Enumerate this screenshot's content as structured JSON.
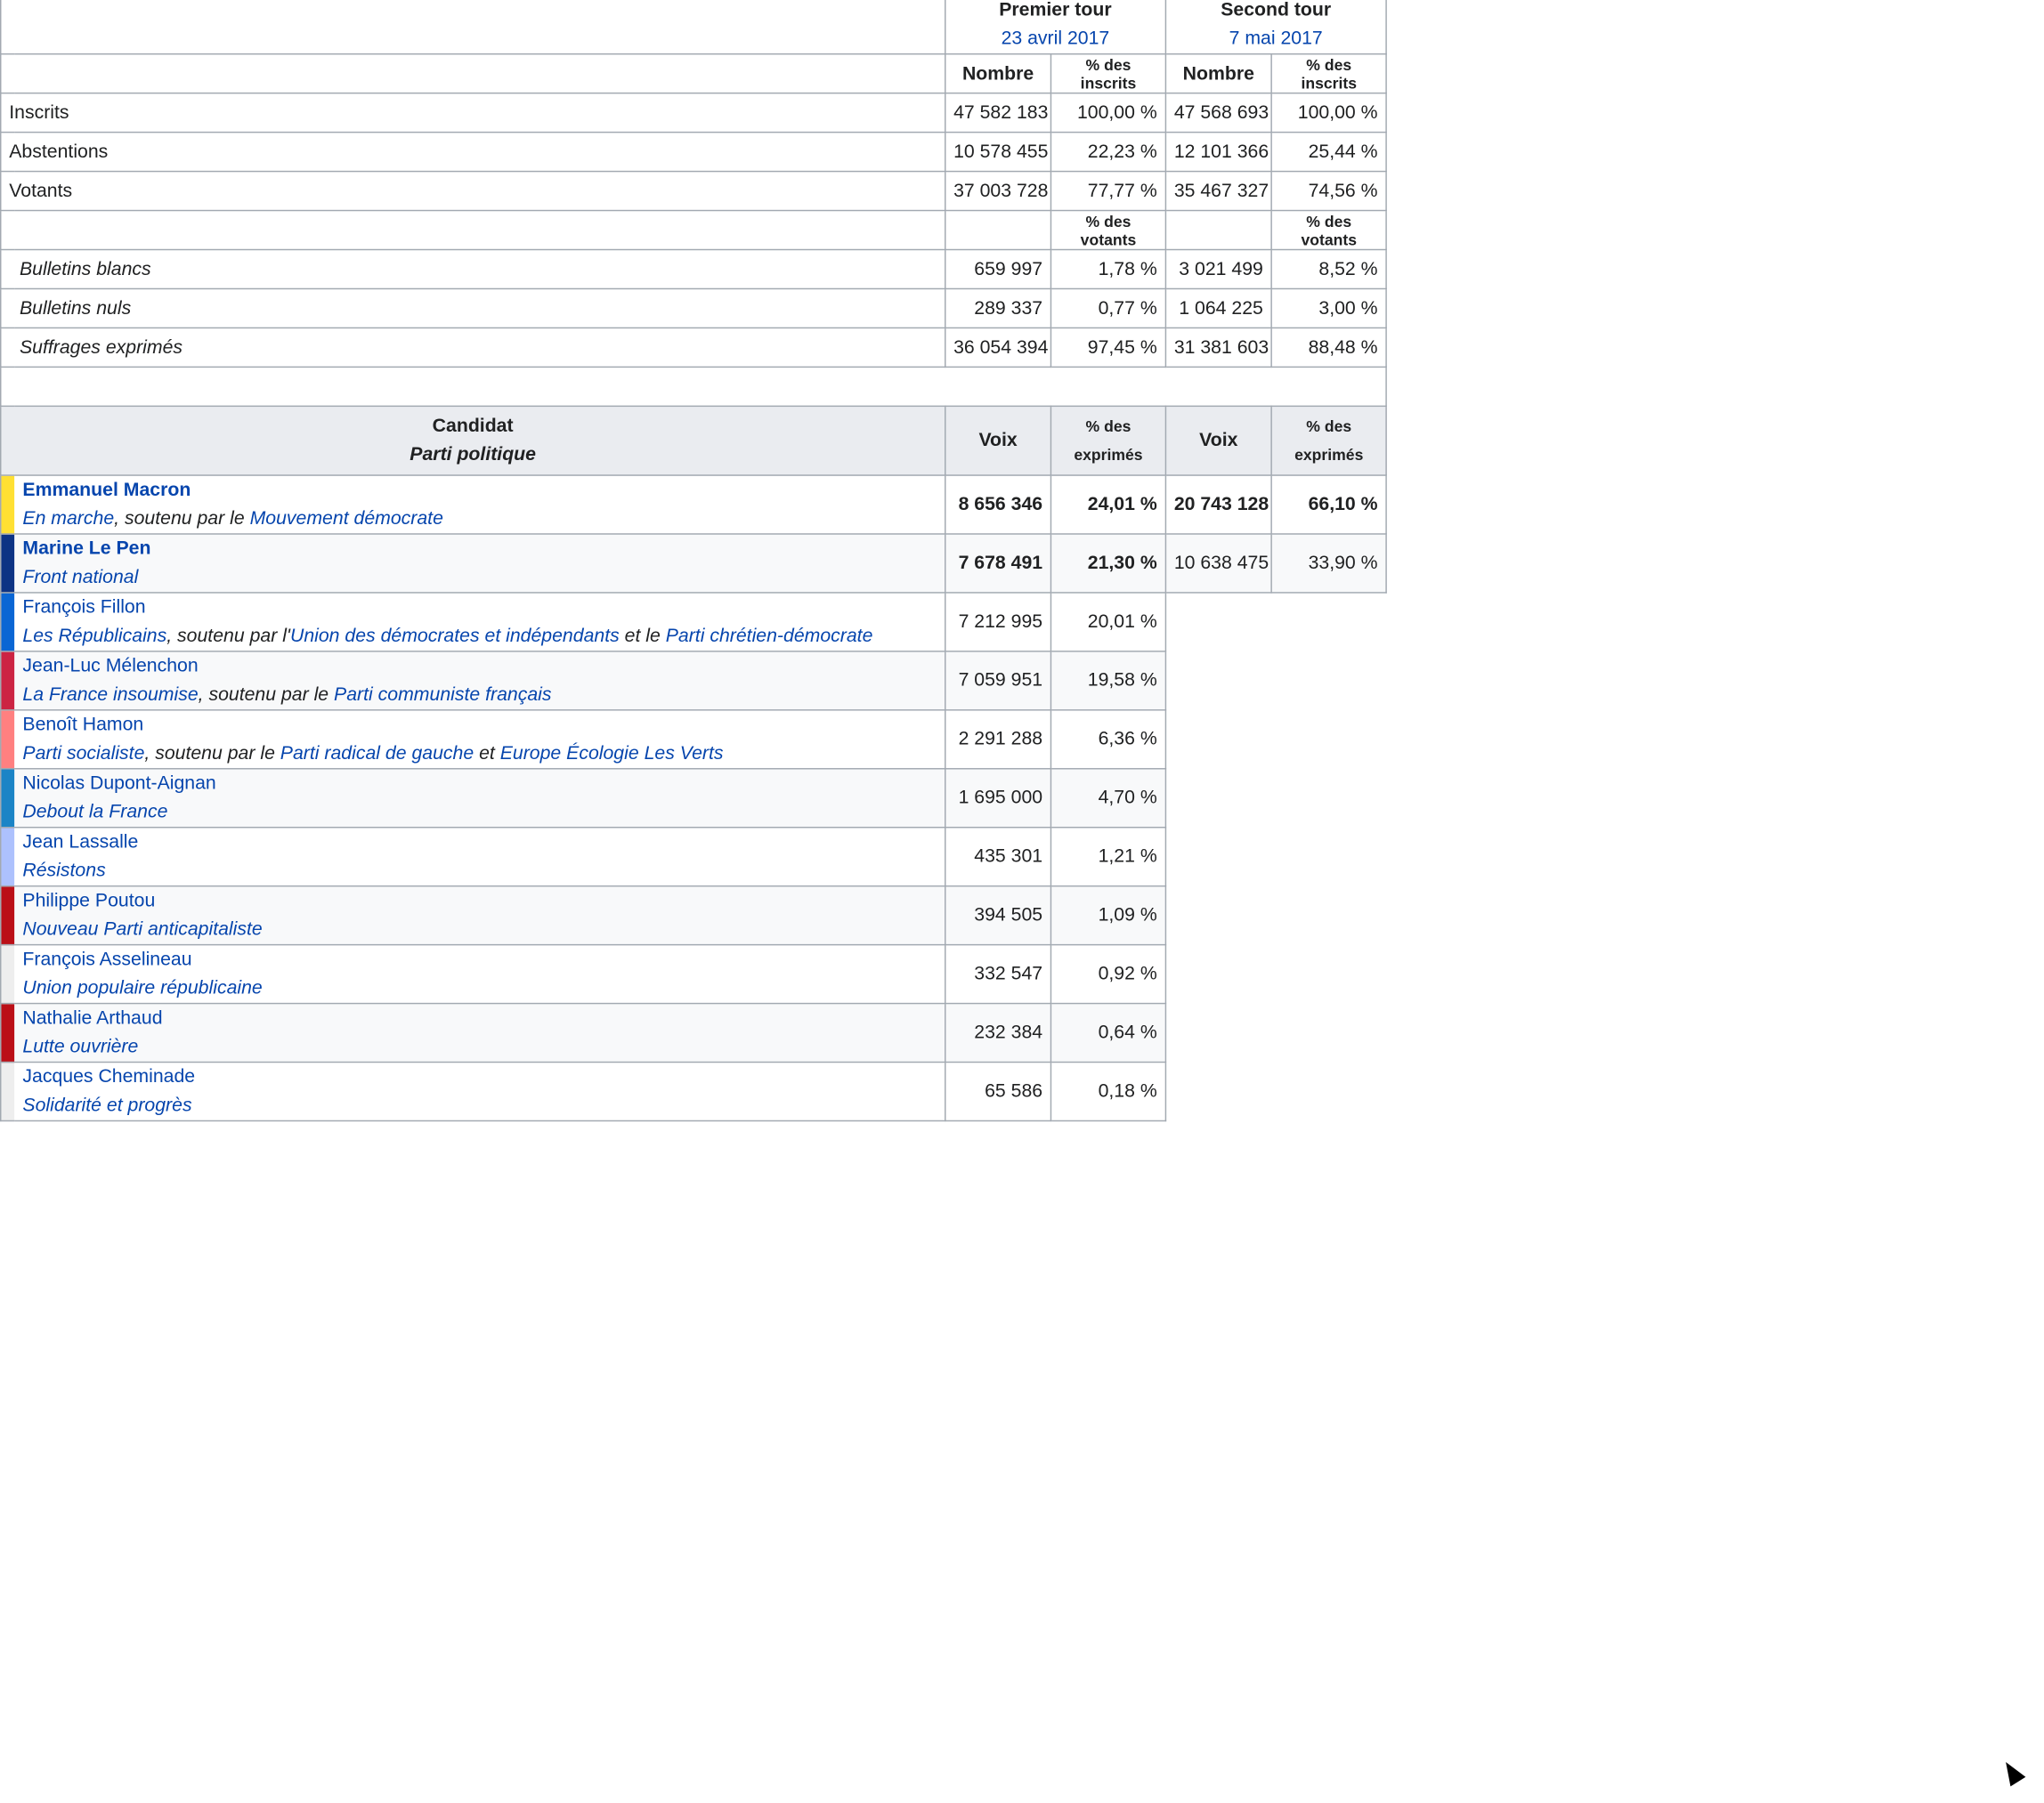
{
  "header": {
    "round1_title": "Premier tour",
    "round1_date": "23 avril 2017",
    "round2_title": "Second tour",
    "round2_date": "7 mai 2017",
    "nombre": "Nombre",
    "pct_inscrits": "% des inscrits",
    "pct_votants": "% des votants"
  },
  "stats": [
    {
      "label": "Inscrits",
      "r1_n": "47 582 183",
      "r1_p": "100,00 %",
      "r2_n": "47 568 693",
      "r2_p": "100,00 %"
    },
    {
      "label": "Abstentions",
      "r1_n": "10 578 455",
      "r1_p": "22,23 %",
      "r2_n": "12 101 366",
      "r2_p": "25,44 %"
    },
    {
      "label": "Votants",
      "r1_n": "37 003 728",
      "r1_p": "77,77 %",
      "r2_n": "35 467 327",
      "r2_p": "74,56 %"
    }
  ],
  "votes": [
    {
      "label": "Bulletins blancs",
      "r1_n": "659 997",
      "r1_p": "1,78 %",
      "r2_n": "3 021 499",
      "r2_p": "8,52 %"
    },
    {
      "label": "Bulletins nuls",
      "r1_n": "289 337",
      "r1_p": "0,77 %",
      "r2_n": "1 064 225",
      "r2_p": "3,00 %"
    },
    {
      "label": "Suffrages exprimés",
      "r1_n": "36 054 394",
      "r1_p": "97,45 %",
      "r2_n": "31 381 603",
      "r2_p": "88,48 %"
    }
  ],
  "cand_header": {
    "candidat": "Candidat",
    "parti": "Parti politique",
    "voix": "Voix",
    "pct_des": "% des",
    "exprimes": "exprimés"
  },
  "candidates": [
    {
      "name": "Emmanuel Macron",
      "color": "#ffe033",
      "party": "En marche",
      "support_text": ", soutenu par le ",
      "s1": "Mouvement démocrate",
      "mid": "",
      "s2": "",
      "r1_voix": "8 656 346",
      "r1_pct": "24,01 %",
      "r2_voix": "20 743 128",
      "r2_pct": "66,10 %"
    },
    {
      "name": "Marine Le Pen",
      "color": "#0d3384",
      "party": "Front national",
      "support_text": "",
      "s1": "",
      "mid": "",
      "s2": "",
      "r1_voix": "7 678 491",
      "r1_pct": "21,30 %",
      "r2_voix": "10 638 475",
      "r2_pct": "33,90 %"
    },
    {
      "name": "François Fillon",
      "color": "#0a66d4",
      "party": "Les Républicains",
      "support_text": ", soutenu par l'",
      "s1": "Union des démocrates et indépendants",
      "mid": " et le ",
      "s2": "Parti chrétien-démocrate",
      "r1_voix": "7 212 995",
      "r1_pct": "20,01 %"
    },
    {
      "name": "Jean-Luc Mélenchon",
      "color": "#cc2443",
      "party": "La France insoumise",
      "support_text": ", soutenu par le ",
      "s1": "Parti communiste français",
      "mid": "",
      "s2": "",
      "r1_voix": "7 059 951",
      "r1_pct": "19,58 %"
    },
    {
      "name": "Benoît Hamon",
      "color": "#ff8080",
      "party": "Parti socialiste",
      "support_text": ", soutenu par le ",
      "s1": "Parti radical de gauche",
      "mid": " et ",
      "s2": "Europe Écologie Les Verts",
      "r1_voix": "2 291 288",
      "r1_pct": "6,36 %"
    },
    {
      "name": "Nicolas Dupont-Aignan",
      "color": "#1b84c6",
      "party": "Debout la France",
      "support_text": "",
      "s1": "",
      "mid": "",
      "s2": "",
      "r1_voix": "1 695 000",
      "r1_pct": "4,70 %"
    },
    {
      "name": "Jean Lassalle",
      "color": "#adc1fd",
      "party": "Résistons",
      "support_text": "",
      "s1": "",
      "mid": "",
      "s2": "",
      "r1_voix": "435 301",
      "r1_pct": "1,21 %"
    },
    {
      "name": "Philippe Poutou",
      "color": "#bb0f17",
      "party": "Nouveau Parti anticapitaliste",
      "support_text": "",
      "s1": "",
      "mid": "",
      "s2": "",
      "r1_voix": "394 505",
      "r1_pct": "1,09 %"
    },
    {
      "name": "François Asselineau",
      "color": "#eeeeee",
      "party": "Union populaire républicaine",
      "support_text": "",
      "s1": "",
      "mid": "",
      "s2": "",
      "r1_voix": "332 547",
      "r1_pct": "0,92 %"
    },
    {
      "name": "Nathalie Arthaud",
      "color": "#bb0f17",
      "party": "Lutte ouvrière",
      "support_text": "",
      "s1": "",
      "mid": "",
      "s2": "",
      "r1_voix": "232 384",
      "r1_pct": "0,64 %"
    },
    {
      "name": "Jacques Cheminade",
      "color": "#eeeeee",
      "party": "Solidarité et progrès",
      "support_text": "",
      "s1": "",
      "mid": "",
      "s2": "",
      "r1_voix": "65 586",
      "r1_pct": "0,18 %"
    }
  ]
}
